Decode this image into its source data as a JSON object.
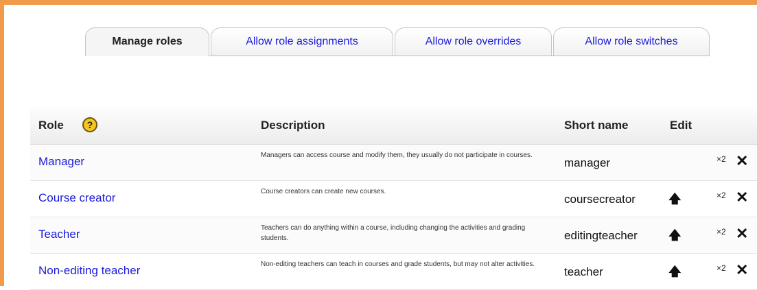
{
  "tabs": [
    {
      "label": "Manage roles",
      "active": true
    },
    {
      "label": "Allow role assignments",
      "active": false
    },
    {
      "label": "Allow role overrides",
      "active": false
    },
    {
      "label": "Allow role switches",
      "active": false
    }
  ],
  "table": {
    "headers": {
      "role": "Role",
      "help": "?",
      "description": "Description",
      "short_name": "Short name",
      "edit": "Edit"
    },
    "rows": [
      {
        "role": "Manager",
        "description": "Managers can access course and modify them, they usually do not participate in courses.",
        "short_name": "manager",
        "move_up": false,
        "duplicate": "×2",
        "delete": "✕"
      },
      {
        "role": "Course creator",
        "description": "Course creators can create new courses.",
        "short_name": "coursecreator",
        "move_up": true,
        "duplicate": "×2",
        "delete": "✕"
      },
      {
        "role": "Teacher",
        "description": "Teachers can do anything within a course, including changing the activities and grading students.",
        "short_name": "editingteacher",
        "move_up": true,
        "duplicate": "×2",
        "delete": "✕"
      },
      {
        "role": "Non-editing teacher",
        "description": "Non-editing teachers can teach in courses and grade students, but may not alter activities.",
        "short_name": "teacher",
        "move_up": true,
        "duplicate": "×2",
        "delete": "✕"
      }
    ]
  },
  "icons": {
    "help": "help-icon",
    "move_up": "arrow-up-icon",
    "duplicate": "duplicate-icon",
    "delete": "delete-icon"
  },
  "colors": {
    "frame": "#f09a4a",
    "link": "#1a1adc",
    "help_icon": "#f4c623"
  }
}
